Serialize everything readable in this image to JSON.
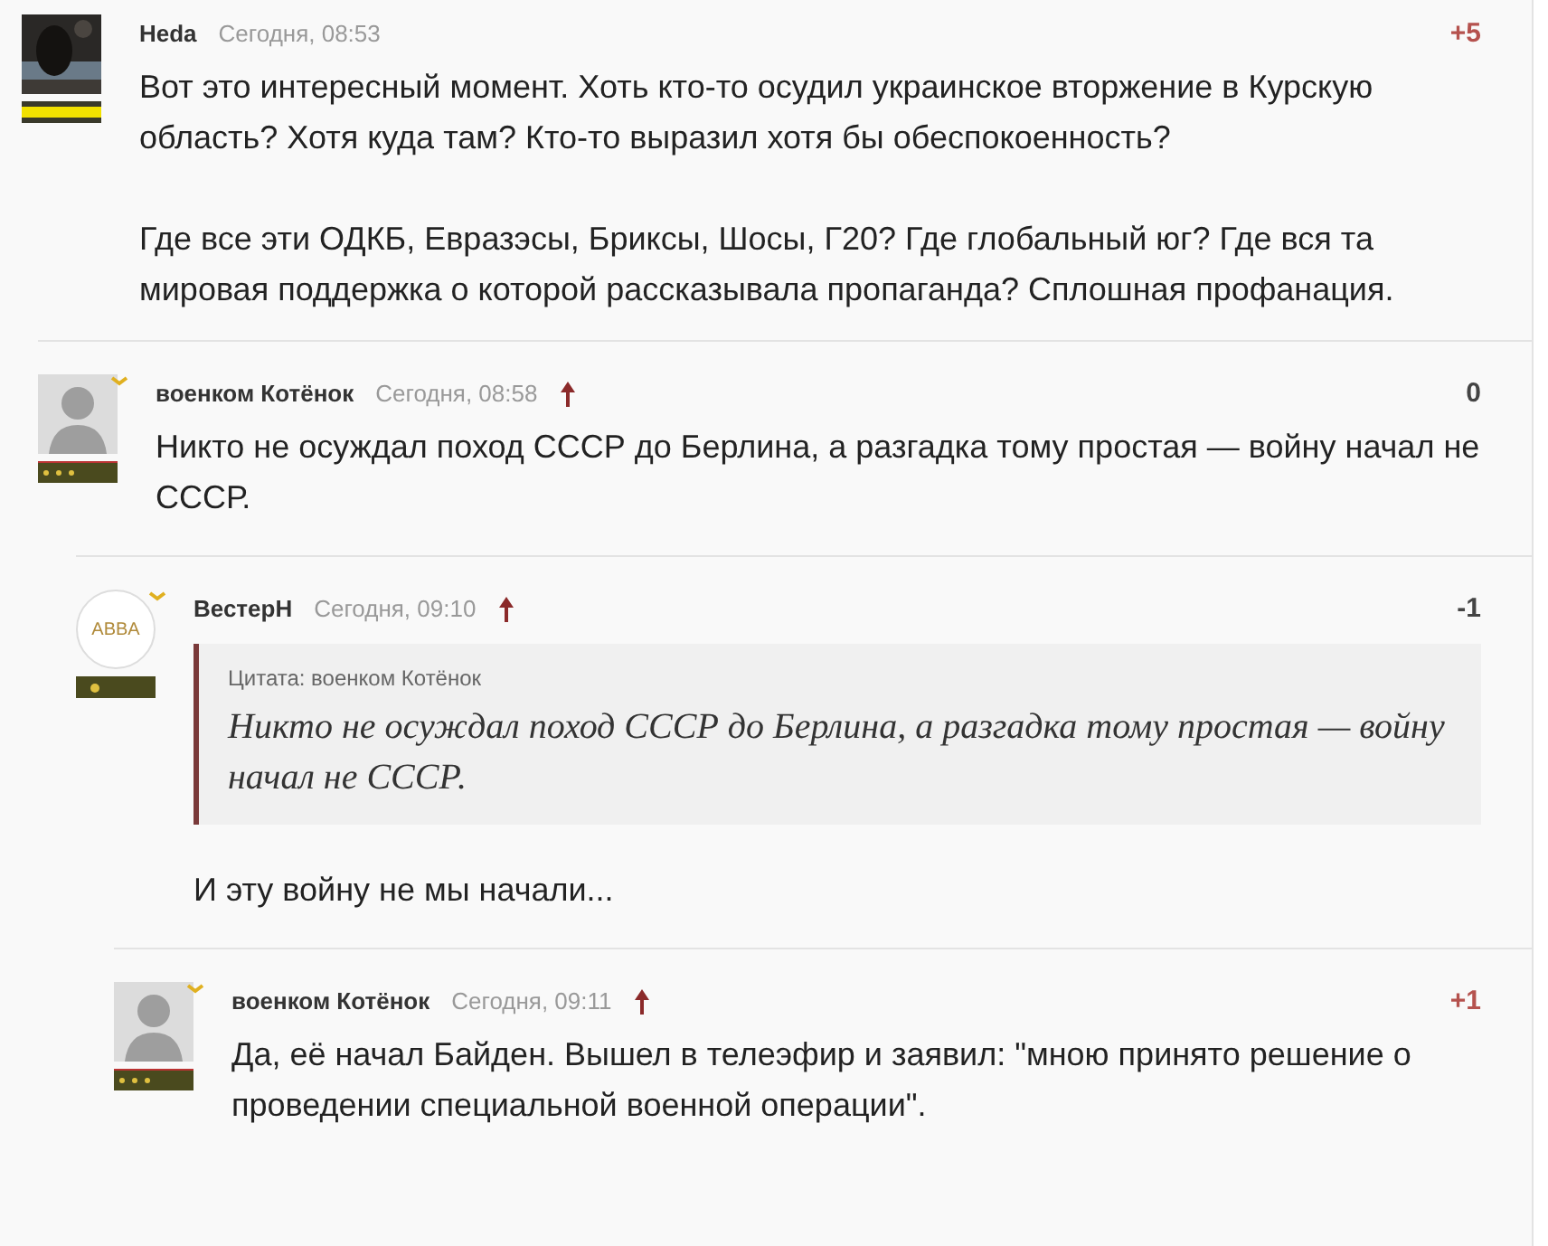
{
  "comments": [
    {
      "author": "Heda",
      "time": "Сегодня, 08:53",
      "rating": "+5",
      "kind": "positive",
      "reply_arrow": false,
      "avatar": {
        "kind": "picture",
        "badge": {
          "kind": "stripes"
        }
      },
      "paragraphs": [
        "Вот это интересный момент. Хоть кто-то осудил украинское вторжение в Курскую область? Хотя куда там? Кто-то выразил хотя бы обеспокоенность?",
        "Где все эти ОДКБ, Евразэсы, Бриксы, Шосы, Г20? Где глобальный юг? Где вся та мировая поддержка о которой рассказывала пропаганда? Сплошная профанация."
      ],
      "children": [
        {
          "author": "военком Котёнок",
          "time": "Сегодня, 08:58",
          "rating": "0",
          "kind": "neutral",
          "reply_arrow": true,
          "avatar": {
            "kind": "silhouette",
            "badge": {
              "kind": "dots"
            }
          },
          "paragraphs": [
            "Никто не осуждал поход СССР до Берлина, а разгадка тому простая — войну начал не СССР."
          ],
          "children": [
            {
              "author": "ВестерН",
              "time": "Сегодня, 09:10",
              "rating": "-1",
              "kind": "negative",
              "reply_arrow": true,
              "avatar": {
                "kind": "logo",
                "text": "ABBA",
                "badge": {
                  "kind": "star"
                }
              },
              "quote": {
                "label": "Цитата: военком Котёнок",
                "text": "Никто не осуждал поход СССР до Берлина, а разгадка тому простая — войну начал не СССР."
              },
              "paragraphs": [
                "И эту войну не мы начали..."
              ],
              "children": [
                {
                  "author": "военком Котёнок",
                  "time": "Сегодня, 09:11",
                  "rating": "+1",
                  "kind": "positive",
                  "reply_arrow": true,
                  "avatar": {
                    "kind": "silhouette",
                    "badge": {
                      "kind": "dots"
                    }
                  },
                  "paragraphs": [
                    "Да, её начал Байден. Вышел в телеэфир и заявил: \"мною принято решение о проведении специальной военной операции\"."
                  ]
                }
              ]
            }
          ]
        }
      ]
    }
  ]
}
